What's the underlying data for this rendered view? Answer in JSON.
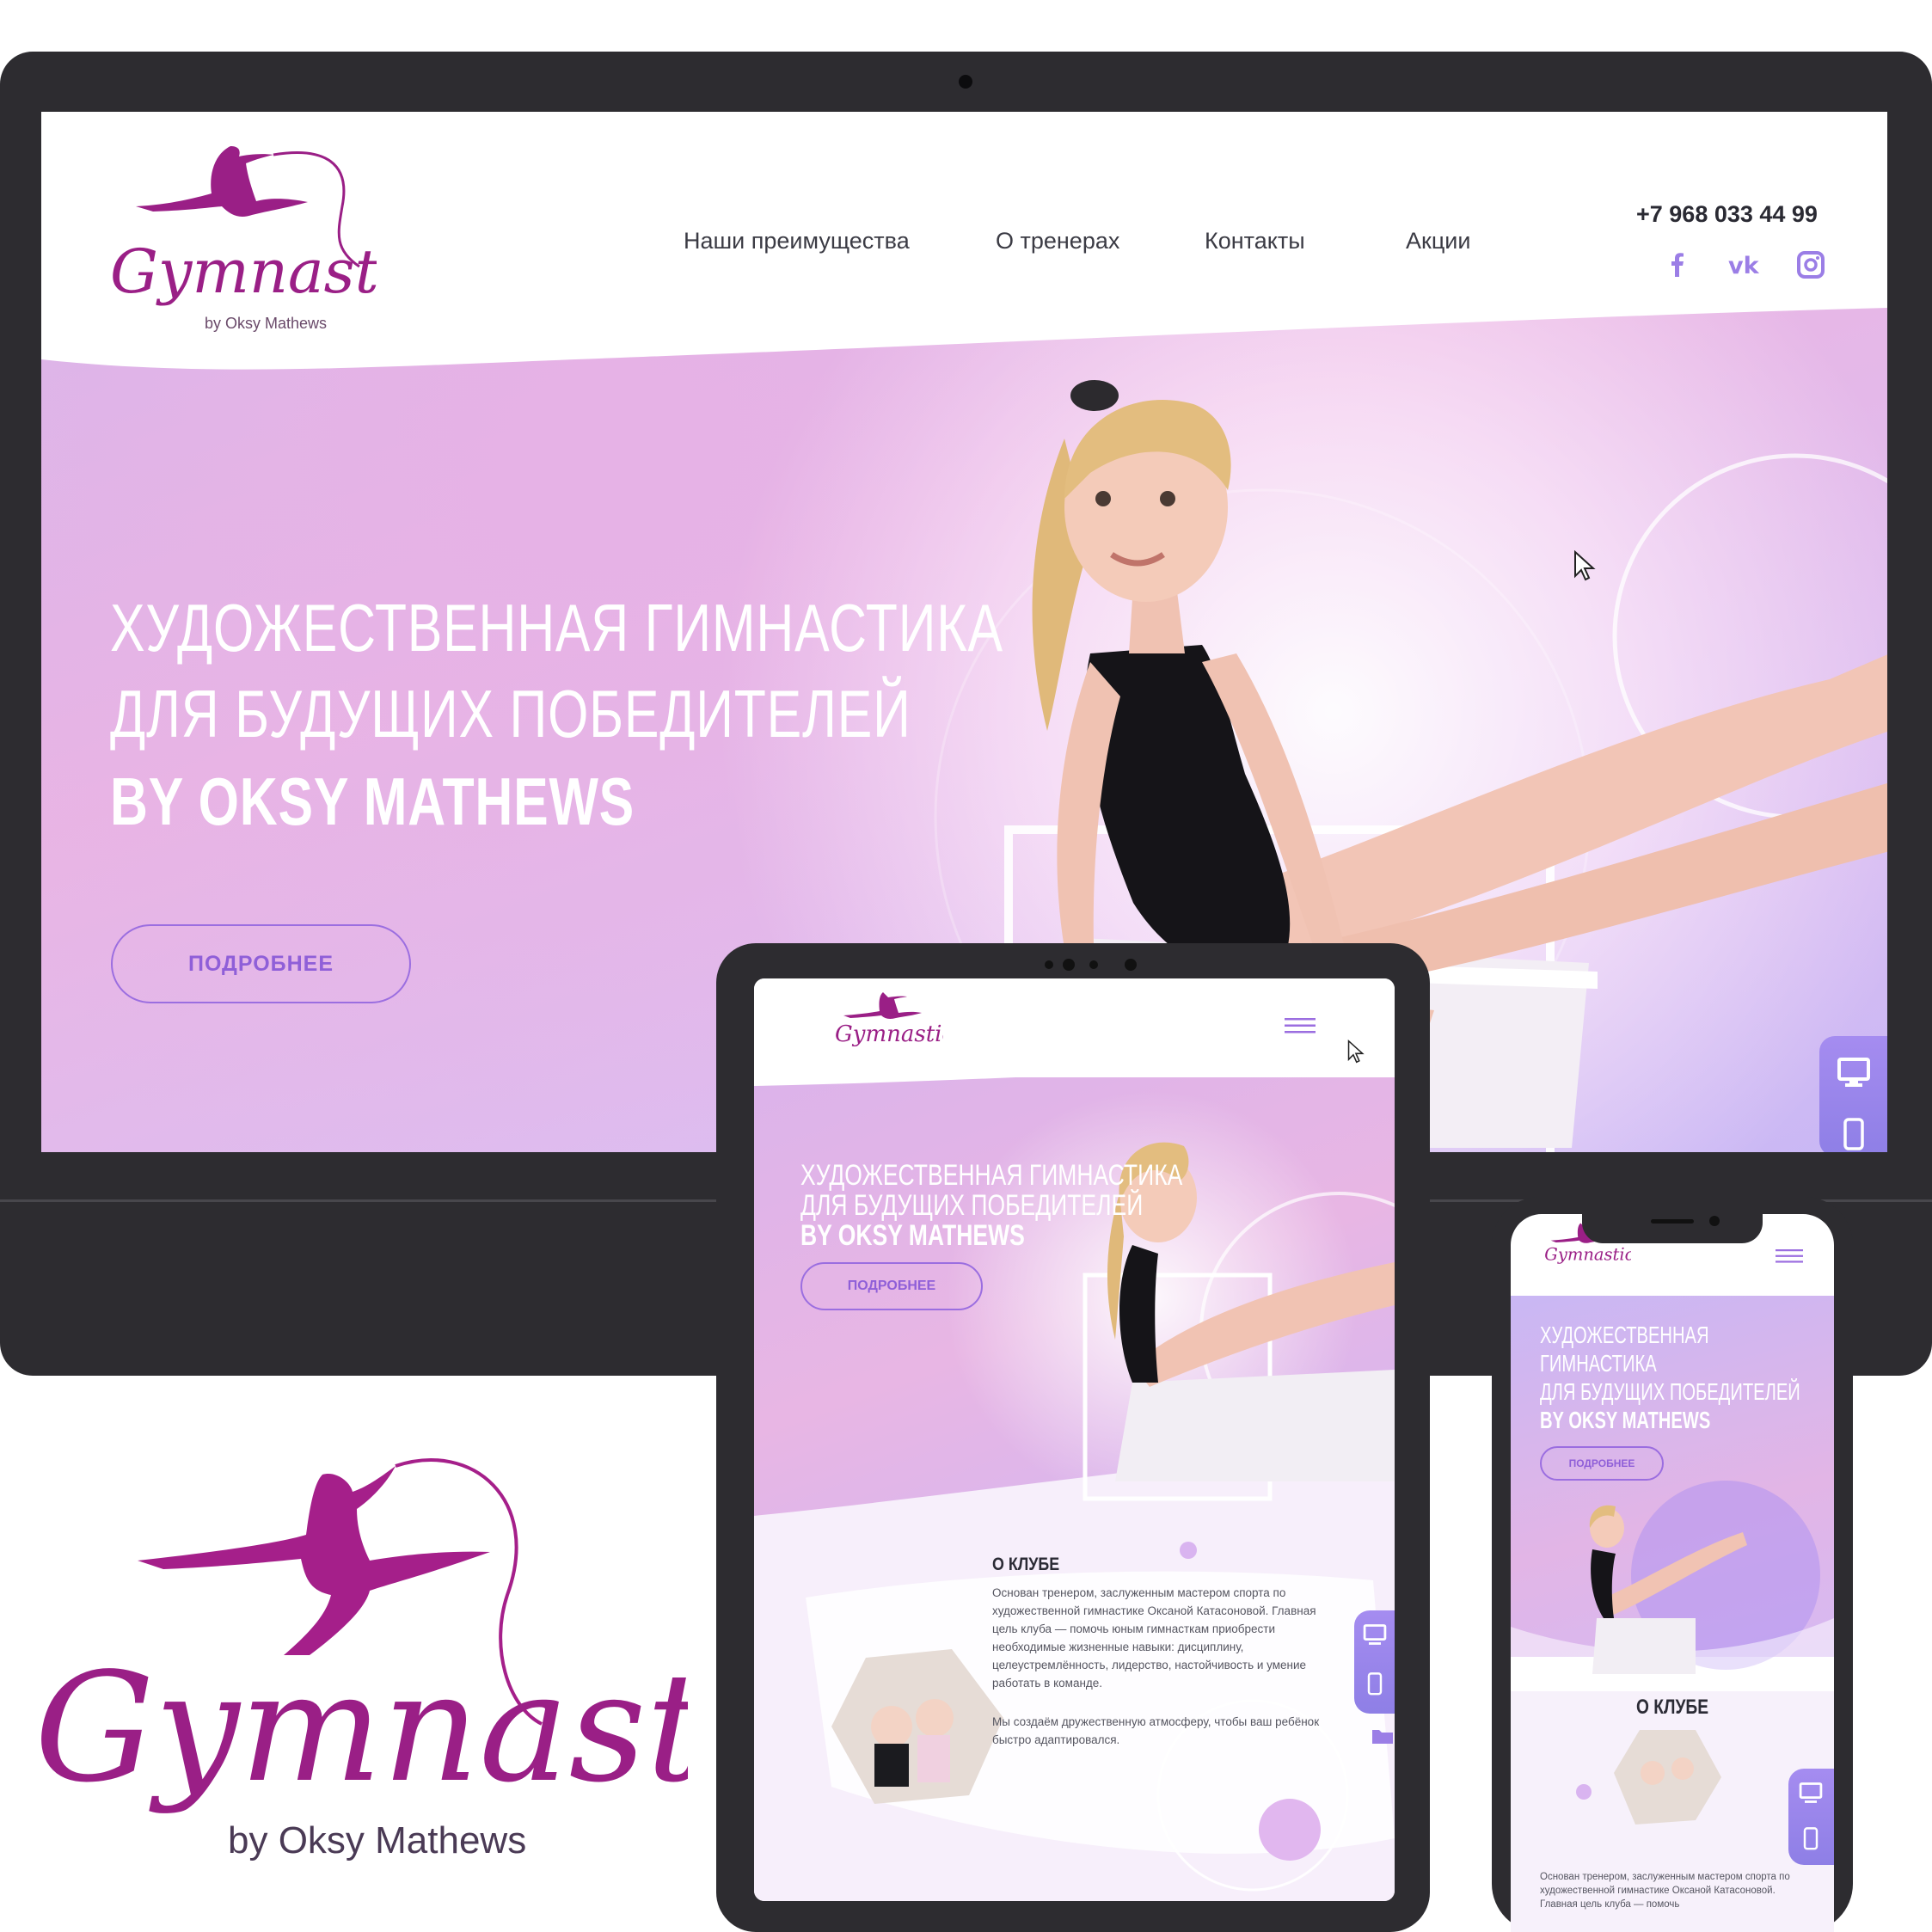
{
  "brand": {
    "logo_script": "Gymnastics",
    "logo_byline": "by Oksy Mathews"
  },
  "desktop": {
    "nav": [
      "Наши преимущества",
      "О тренерах",
      "Контакты",
      "Акции"
    ],
    "phone": "+7 968 033 44 99",
    "social": [
      "facebook-icon",
      "vk-icon",
      "instagram-icon"
    ],
    "hero": {
      "line1": "ХУДОЖЕСТВЕННАЯ ГИМНАСТИКА",
      "line2": "ДЛЯ БУДУЩИХ ПОБЕДИТЕЛЕЙ",
      "line3": "BY OKSY MATHEWS",
      "button": "ПОДРОБНЕЕ"
    }
  },
  "tablet": {
    "hero": {
      "line1": "ХУДОЖЕСТВЕННАЯ ГИМНАСТИКА",
      "line2": "ДЛЯ БУДУЩИХ ПОБЕДИТЕЛЕЙ",
      "line3": "BY OKSY MATHEWS",
      "button": "ПОДРОБНЕЕ"
    },
    "about": {
      "title": "О КЛУБЕ",
      "p1": "Основан тренером, заслуженным мастером спорта по художественной гимнастике Оксаной Катасоновой. Главная цель клуба — помочь юным гимнасткам приобрести необходимые жизненные навыки: дисциплину, целеустремлённость, лидерство, настойчивость и умение работать в команде.",
      "p2": "Мы создаём дружественную атмосферу, чтобы ваш ребёнок быстро адаптировался."
    }
  },
  "mobile": {
    "hero": {
      "line1": "ХУДОЖЕСТВЕННАЯ",
      "line2": "ГИМНАСТИКА",
      "line3": "ДЛЯ БУДУЩИХ ПОБЕДИТЕЛЕЙ",
      "line4": "BY OKSY MATHEWS",
      "button": "ПОДРОБНЕЕ"
    },
    "about": {
      "title": "О КЛУБЕ",
      "text": "Основан тренером, заслуженным мастером спорта по художественной гимнастике Оксаной Катасоновой. Главная цель клуба — помочь"
    }
  },
  "colors": {
    "brand_magenta": "#9a1f86",
    "accent_violet": "#9b6ee0",
    "device_frame": "#2d2c30"
  }
}
